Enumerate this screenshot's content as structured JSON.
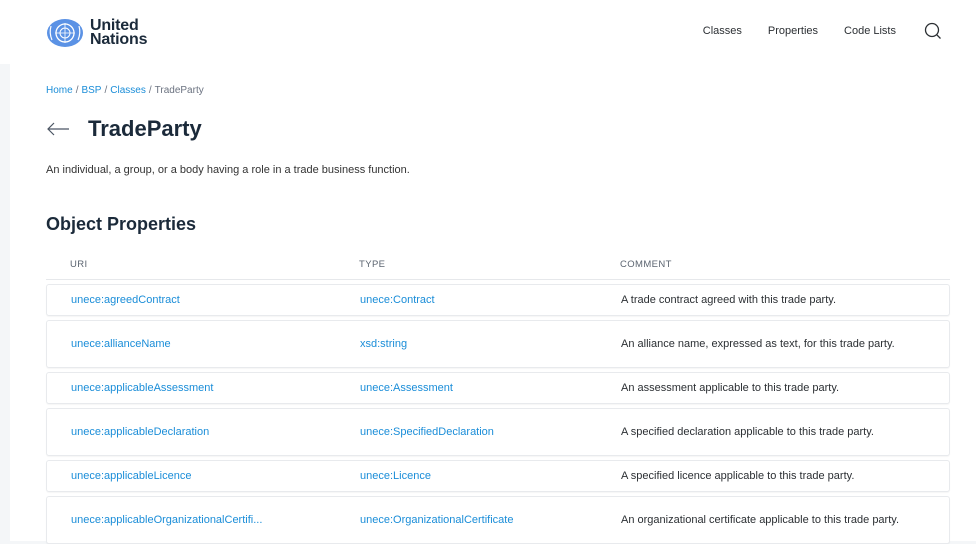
{
  "header": {
    "logo": {
      "line1": "United",
      "line2": "Nations"
    },
    "nav": [
      {
        "label": "Classes"
      },
      {
        "label": "Properties"
      },
      {
        "label": "Code Lists"
      }
    ],
    "search_icon": "search-icon"
  },
  "breadcrumb": {
    "items": [
      "Home",
      "BSP",
      "Classes"
    ],
    "current": "TradeParty"
  },
  "page": {
    "title": "TradeParty",
    "description": "An individual, a group, or a body having a role in a trade business function."
  },
  "section": {
    "title": "Object Properties",
    "columns": [
      "URI",
      "TYPE",
      "COMMENT"
    ],
    "rows": [
      {
        "uri": "unece:agreedContract",
        "type": "unece:Contract",
        "comment": "A trade contract agreed with this trade party."
      },
      {
        "uri": "unece:allianceName",
        "type": "xsd:string",
        "comment": "An alliance name, expressed as text, for this trade party."
      },
      {
        "uri": "unece:applicableAssessment",
        "type": "unece:Assessment",
        "comment": "An assessment applicable to this trade party."
      },
      {
        "uri": "unece:applicableDeclaration",
        "type": "unece:SpecifiedDeclaration",
        "comment": "A specified declaration applicable to this trade party."
      },
      {
        "uri": "unece:applicableLicence",
        "type": "unece:Licence",
        "comment": "A specified licence applicable to this trade party."
      },
      {
        "uri": "unece:applicableOrganizationalCertifi...",
        "type": "unece:OrganizationalCertificate",
        "comment": "An organizational certificate applicable to this trade party."
      }
    ]
  },
  "colors": {
    "link": "#1a8dd8",
    "title": "#1b2a3a",
    "un_blue": "#5b92e5"
  }
}
